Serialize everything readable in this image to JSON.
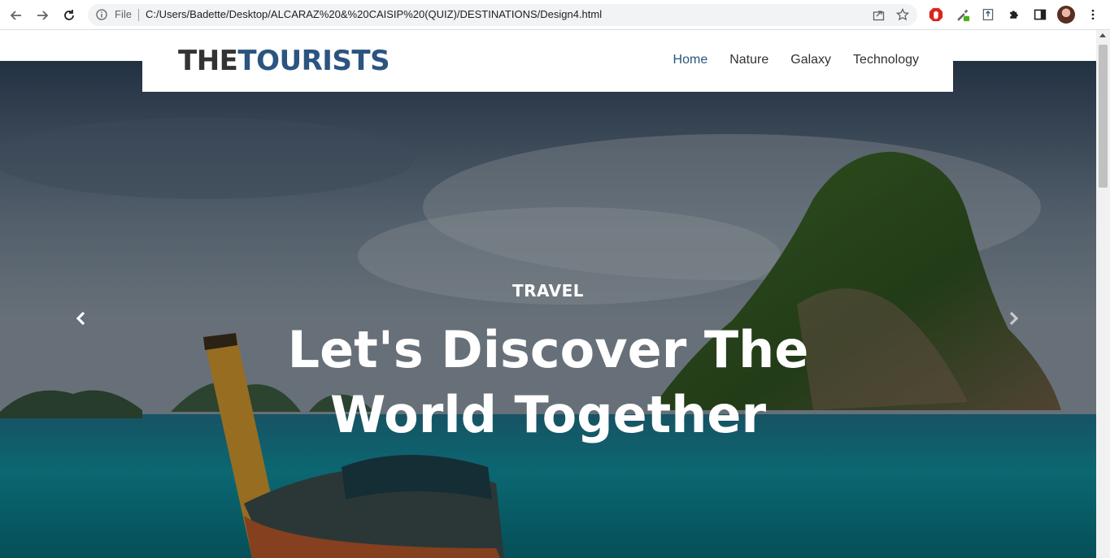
{
  "browser": {
    "file_label": "File",
    "url": "C:/Users/Badette/Desktop/ALCARAZ%20&%20CAISIP%20(QUIZ)/DESTINATIONS/Design4.html"
  },
  "site": {
    "logo_part1": "THE",
    "logo_part2": "TOURISTS",
    "nav": [
      "Home",
      "Nature",
      "Galaxy",
      "Technology"
    ],
    "active_nav": "Home"
  },
  "hero": {
    "eyebrow": "TRAVEL",
    "headline_line1": "Let's Discover The",
    "headline_line2": "World Together"
  },
  "colors": {
    "logo_dark": "#333333",
    "logo_accent": "#2b5480",
    "nav_active": "#2b5480"
  },
  "icons": [
    "back-icon",
    "forward-icon",
    "reload-icon",
    "info-icon",
    "share-icon",
    "star-icon",
    "extension-icon",
    "puzzle-icon",
    "sidepanel-icon",
    "menu-icon",
    "chevron-left-icon",
    "chevron-right-icon"
  ]
}
